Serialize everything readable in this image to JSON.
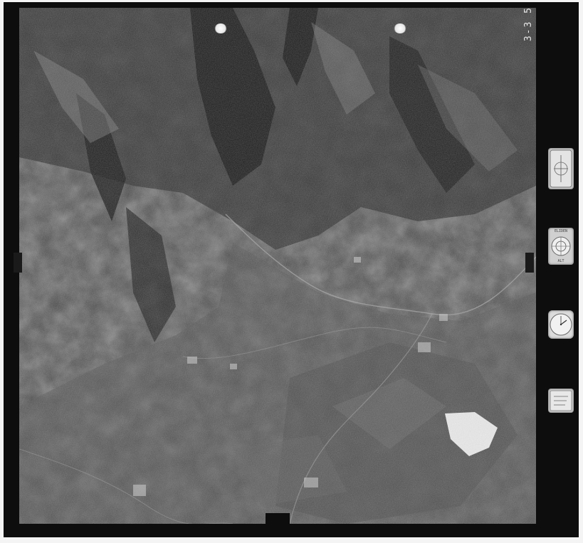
{
  "photo": {
    "film_number": "3-3 5"
  },
  "instruments": {
    "level_label_top": "ELIDEN",
    "level_label_bottom": "ALT"
  },
  "colors": {
    "frame": "#0d0d0d",
    "background": "#f4f4f4",
    "terrain_dark": "#1f1f1f",
    "terrain_mid": "#4a4a4a",
    "terrain_light": "#8a8a8a",
    "cloud": "#ececec"
  }
}
